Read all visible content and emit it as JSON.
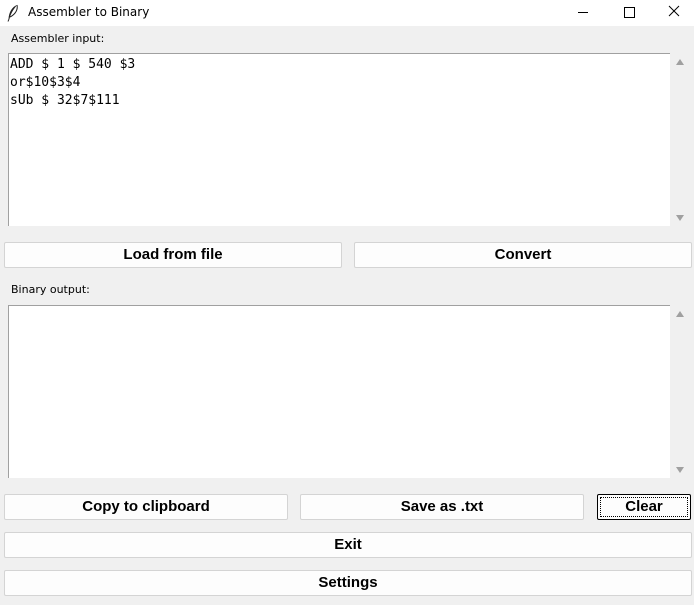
{
  "window": {
    "title": "Assembler to Binary",
    "icon": "feather-icon",
    "controls": [
      "minimize-icon",
      "maximize-icon",
      "close-icon"
    ]
  },
  "input_section": {
    "label": "Assembler input:",
    "lines": [
      "ADD $ 1 $ 540 $3",
      "or$10$3$4",
      "sUb $ 32$7$111"
    ]
  },
  "output_section": {
    "label": "Binary output:",
    "lines": []
  },
  "buttons": {
    "load": "Load from file",
    "convert": "Convert",
    "copy": "Copy to clipboard",
    "save": "Save as .txt",
    "clear": "Clear",
    "exit": "Exit",
    "settings": "Settings"
  },
  "focused_button": "clear"
}
